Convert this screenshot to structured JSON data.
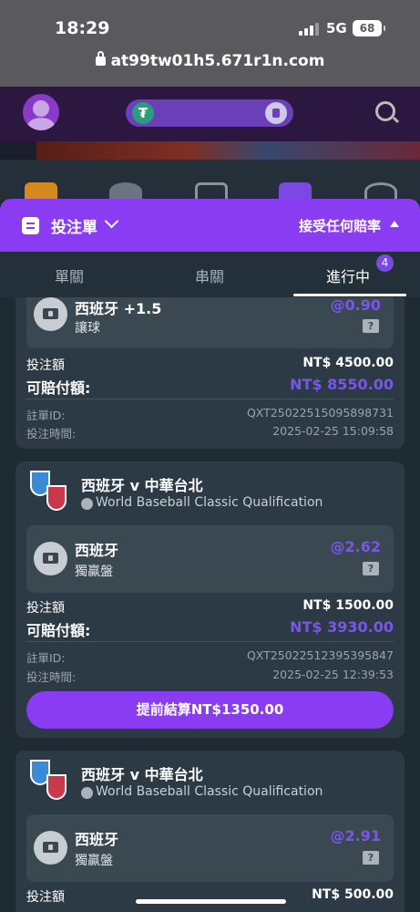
{
  "status_bar": {
    "time": "18:29",
    "network": "5G",
    "battery": "68"
  },
  "browser": {
    "url": "at99tw01h5.671r1n.com"
  },
  "header": {
    "tether_symbol": "₮"
  },
  "bet_slip": {
    "title": "投注單",
    "odds_preference": "接受任何賠率",
    "tabs": [
      {
        "label": "單關"
      },
      {
        "label": "串關"
      },
      {
        "label": "進行中",
        "count": "4"
      }
    ]
  },
  "bets": [
    {
      "selection": "西班牙 +1.5",
      "market": "讓球",
      "odds": "@0.90",
      "stake_label": "投注額",
      "stake": "NT$ 4500.00",
      "payout_label": "可賠付額:",
      "payout": "NT$ 8550.00",
      "id_label": "註單ID:",
      "id": "QXT25022515095898731",
      "time_label": "投注時間:",
      "time": "2025-02-25 15:09:58"
    },
    {
      "match": "西班牙 v 中華台北",
      "league": "World Baseball Classic Qualification",
      "selection": "西班牙",
      "market": "獨贏盤",
      "odds": "@2.62",
      "stake_label": "投注額",
      "stake": "NT$ 1500.00",
      "payout_label": "可賠付額:",
      "payout": "NT$ 3930.00",
      "id_label": "註單ID:",
      "id": "QXT25022512395395847",
      "time_label": "投注時間:",
      "time": "2025-02-25 12:39:53",
      "cashout": "提前結算NT$1350.00"
    },
    {
      "match": "西班牙 v 中華台北",
      "league": "World Baseball Classic Qualification",
      "selection": "西班牙",
      "market": "獨贏盤",
      "odds": "@2.91",
      "stake_label": "投注額",
      "stake": "NT$ 500.00"
    }
  ],
  "icons": [
    "lock-icon",
    "avatar-icon",
    "tether-icon",
    "wallet-icon",
    "search-icon",
    "bet-slip-icon",
    "chevron-down-icon",
    "triangle-up-icon",
    "ticket-icon",
    "team-shield-icon",
    "baseball-icon"
  ]
}
